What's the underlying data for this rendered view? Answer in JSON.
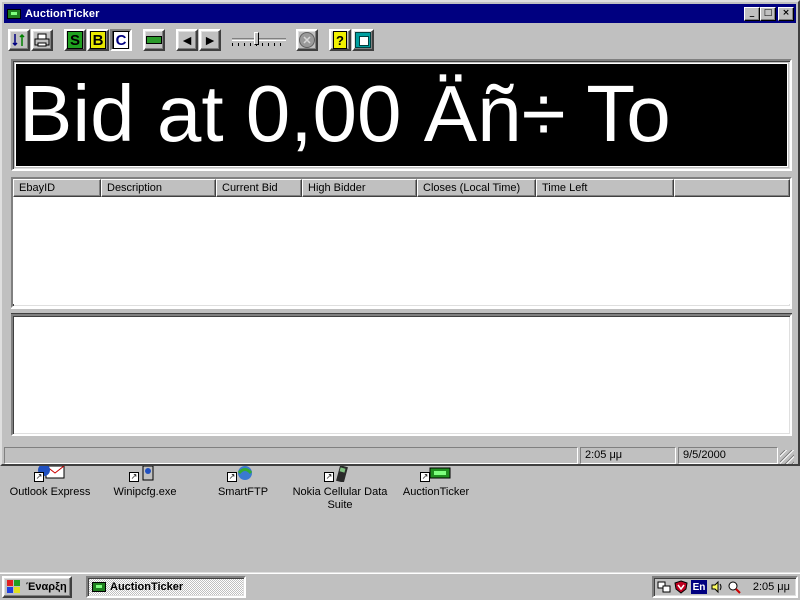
{
  "window": {
    "title": "AuctionTicker",
    "min_label": "_",
    "max_label": "□",
    "close_label": "×"
  },
  "toolbar": {
    "btn_s": "S",
    "btn_b": "B",
    "btn_c": "C",
    "back_arrow": "◄",
    "forward_arrow": "►",
    "help": "?",
    "stop": "✕"
  },
  "ticker": {
    "text": "Bid at 0,00 Äñ÷ To"
  },
  "list": {
    "columns": [
      "EbayID",
      "Description",
      "Current Bid",
      "High Bidder",
      "Closes (Local Time)",
      "Time Left",
      ""
    ]
  },
  "status": {
    "panel1": "",
    "time": "2:05 μμ",
    "date": "9/5/2000"
  },
  "desktop": {
    "icons": [
      {
        "label": "Outlook Express",
        "icon": "outlook-express-icon"
      },
      {
        "label": "Winipcfg.exe",
        "icon": "winipcfg-icon"
      },
      {
        "label": "SmartFTP",
        "icon": "smartftp-icon"
      },
      {
        "label": "Nokia Cellular Data Suite",
        "icon": "nokia-icon"
      },
      {
        "label": "AuctionTicker",
        "icon": "auctionticker-icon"
      }
    ]
  },
  "taskbar": {
    "start_label": "Έναρξη",
    "task_label": "AuctionTicker",
    "lang": "En",
    "clock": "2:05 μμ"
  },
  "colors": {
    "title_bar": "#000080",
    "ticker_bg": "#000000",
    "ticker_fg": "#ffffff",
    "face": "#c0c0c0"
  }
}
